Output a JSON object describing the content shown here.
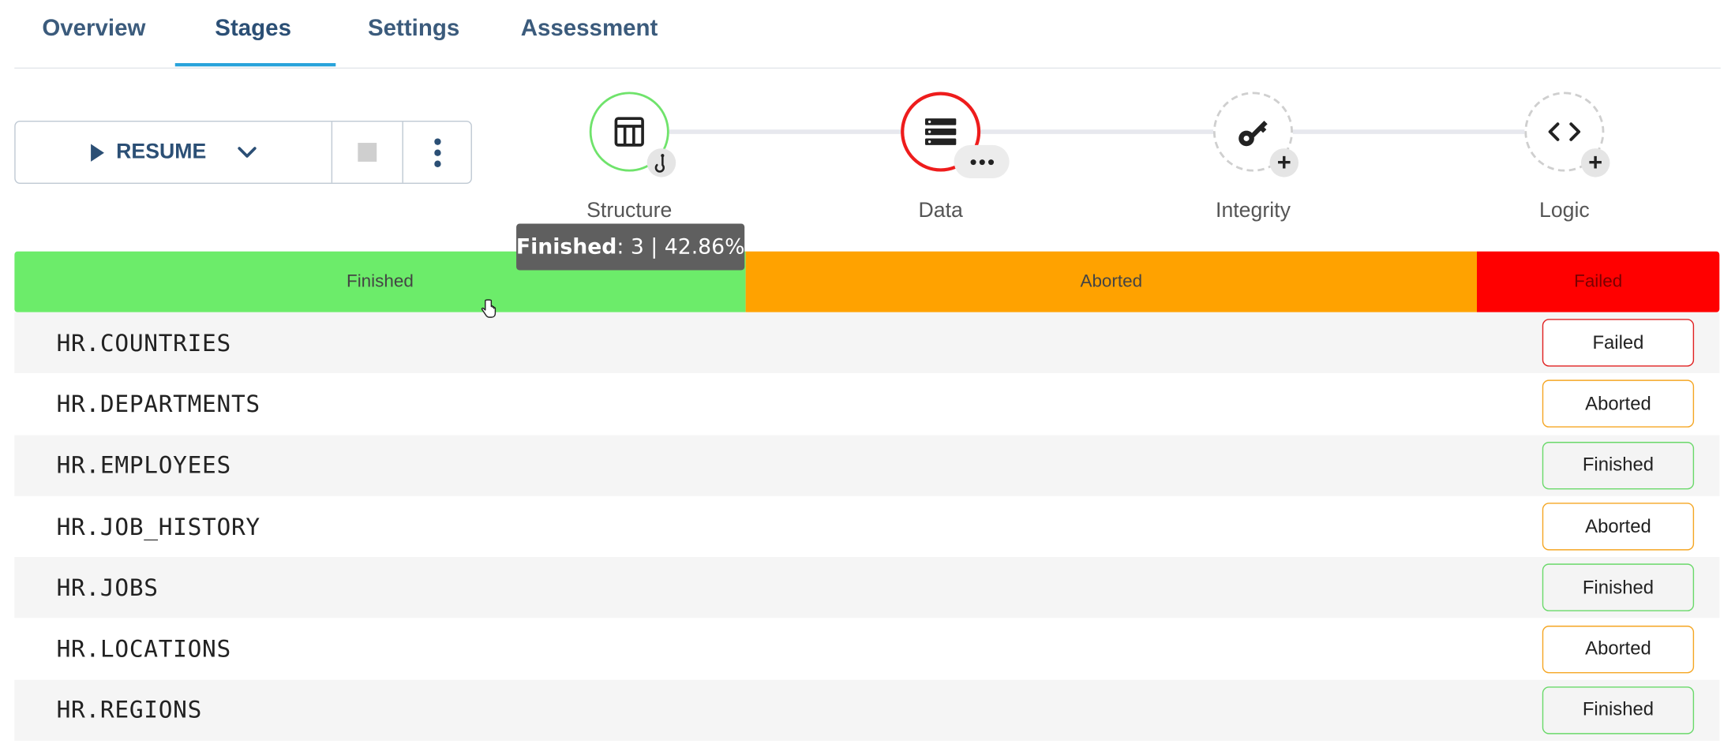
{
  "tabs": [
    {
      "label": "Overview"
    },
    {
      "label": "Stages"
    },
    {
      "label": "Settings"
    },
    {
      "label": "Assessment"
    }
  ],
  "active_tab": "Stages",
  "controls": {
    "resume_label": "RESUME"
  },
  "stages": [
    {
      "label": "Structure",
      "status": "finished",
      "icon": "table-icon",
      "badge": "hook-icon"
    },
    {
      "label": "Data",
      "status": "failed",
      "icon": "database-icon",
      "badge": "more-icon"
    },
    {
      "label": "Integrity",
      "status": "pending",
      "icon": "key-icon",
      "badge": "plus-icon"
    },
    {
      "label": "Logic",
      "status": "pending",
      "icon": "code-icon",
      "badge": "plus-icon"
    }
  ],
  "tooltip": {
    "label": "Finished",
    "detail": ": 3 | 42.86%"
  },
  "progress": {
    "segments": [
      {
        "label": "Finished",
        "fraction": 0.4286,
        "color": "#6cec6a"
      },
      {
        "label": "Aborted",
        "fraction": 0.4286,
        "color": "#ffa200"
      },
      {
        "label": "Failed",
        "fraction": 0.1429,
        "color": "#ff0000"
      }
    ]
  },
  "objects": [
    {
      "name": "HR.COUNTRIES",
      "status": "Failed"
    },
    {
      "name": "HR.DEPARTMENTS",
      "status": "Aborted"
    },
    {
      "name": "HR.EMPLOYEES",
      "status": "Finished"
    },
    {
      "name": "HR.JOB_HISTORY",
      "status": "Aborted"
    },
    {
      "name": "HR.JOBS",
      "status": "Finished"
    },
    {
      "name": "HR.LOCATIONS",
      "status": "Aborted"
    },
    {
      "name": "HR.REGIONS",
      "status": "Finished"
    }
  ]
}
